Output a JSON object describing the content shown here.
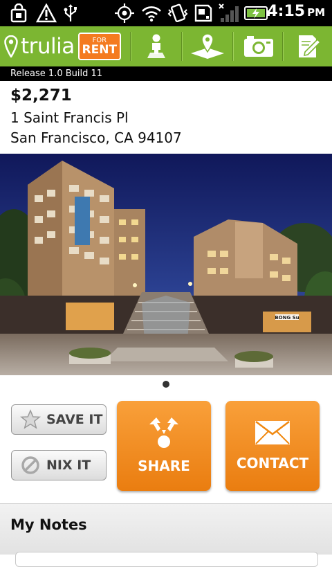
{
  "status_bar": {
    "time": "4:15",
    "ampm": "PM",
    "icons": [
      "lock-notification-icon",
      "warning-icon",
      "usb-icon",
      "gps-icon",
      "wifi-icon",
      "vibrate-icon",
      "sd-card-icon",
      "signal-icon",
      "battery-charging-icon"
    ]
  },
  "app_bar": {
    "logo_text": "trulia",
    "badge_line1": "FOR",
    "badge_line2": "RENT",
    "buttons": [
      "person-icon",
      "map-pin-icon",
      "camera-icon",
      "edit-note-icon"
    ]
  },
  "build_info": "Release 1.0 Build 11",
  "listing": {
    "price": "$2,271",
    "address_line1": "1 Saint Francis Pl",
    "address_line2": "San Francisco, CA 94107",
    "building_sign": "BONG Su",
    "pager_count": 1
  },
  "actions": {
    "save_label": "SAVE IT",
    "nix_label": "NIX IT",
    "share_label": "SHARE",
    "contact_label": "CONTACT"
  },
  "notes": {
    "title": "My Notes"
  },
  "colors": {
    "brand_green": "#7cb632",
    "accent_orange": "#f7941d"
  }
}
